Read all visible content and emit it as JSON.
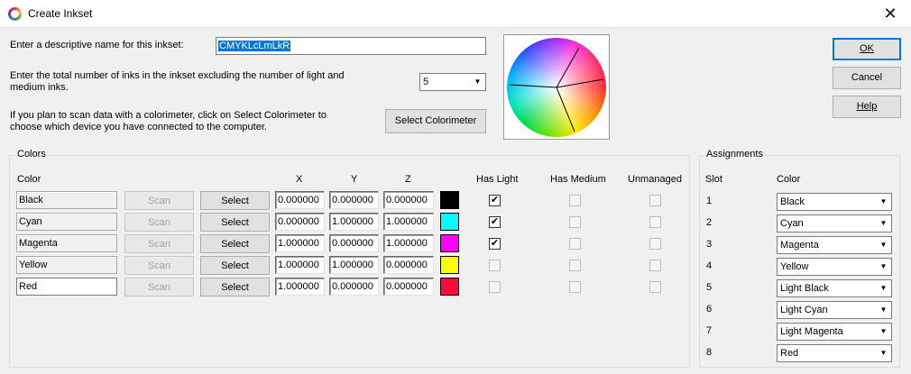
{
  "window": {
    "title": "Create Inkset",
    "close_glyph": "✕"
  },
  "prompts": {
    "name_label": "Enter a descriptive name for this inkset:",
    "name_value": "CMYKLcLmLkR",
    "ink_count_label_1": "Enter the total number of inks in the inkset excluding the number of light and",
    "ink_count_label_2": "medium inks.",
    "ink_count_value": "5",
    "colorimeter_label_1": "If you plan to scan data with a colorimeter, click on Select Colorimeter to",
    "colorimeter_label_2": "choose which device you have connected to the computer.",
    "select_colorimeter_label": "Select Colorimeter"
  },
  "buttons": {
    "ok": "OK",
    "cancel": "Cancel",
    "help": "Help"
  },
  "colors_group": {
    "title": "Colors",
    "headers": {
      "color": "Color",
      "x": "X",
      "y": "Y",
      "z": "Z",
      "has_light": "Has Light",
      "has_medium": "Has Medium",
      "unmanaged": "Unmanaged"
    },
    "scan_label": "Scan",
    "select_label": "Select",
    "rows": [
      {
        "name": "Black",
        "x": "0.000000",
        "y": "0.000000",
        "z": "0.000000",
        "swatch": "#000000",
        "has_light": "✔",
        "has_medium": "",
        "unmanaged": ""
      },
      {
        "name": "Cyan",
        "x": "0.000000",
        "y": "1.000000",
        "z": "1.000000",
        "swatch": "#00ffff",
        "has_light": "✔",
        "has_medium": "",
        "unmanaged": ""
      },
      {
        "name": "Magenta",
        "x": "1.000000",
        "y": "0.000000",
        "z": "1.000000",
        "swatch": "#ff00ff",
        "has_light": "✔",
        "has_medium": "",
        "unmanaged": ""
      },
      {
        "name": "Yellow",
        "x": "1.000000",
        "y": "1.000000",
        "z": "0.000000",
        "swatch": "#ffff00",
        "has_light": "",
        "has_medium": "",
        "unmanaged": ""
      },
      {
        "name": "Red",
        "x": "1.000000",
        "y": "0.000000",
        "z": "0.000000",
        "swatch": "#ff0a3c",
        "has_light": "",
        "has_medium": "",
        "unmanaged": ""
      }
    ]
  },
  "assignments_group": {
    "title": "Assignments",
    "headers": {
      "slot": "Slot",
      "color": "Color"
    },
    "rows": [
      {
        "slot": "1",
        "color": "Black"
      },
      {
        "slot": "2",
        "color": "Cyan"
      },
      {
        "slot": "3",
        "color": "Magenta"
      },
      {
        "slot": "4",
        "color": "Yellow"
      },
      {
        "slot": "5",
        "color": "Light Black"
      },
      {
        "slot": "6",
        "color": "Light Cyan"
      },
      {
        "slot": "7",
        "color": "Light Magenta"
      },
      {
        "slot": "8",
        "color": "Red"
      }
    ]
  },
  "icons": {
    "combo_arrow": "▼"
  }
}
